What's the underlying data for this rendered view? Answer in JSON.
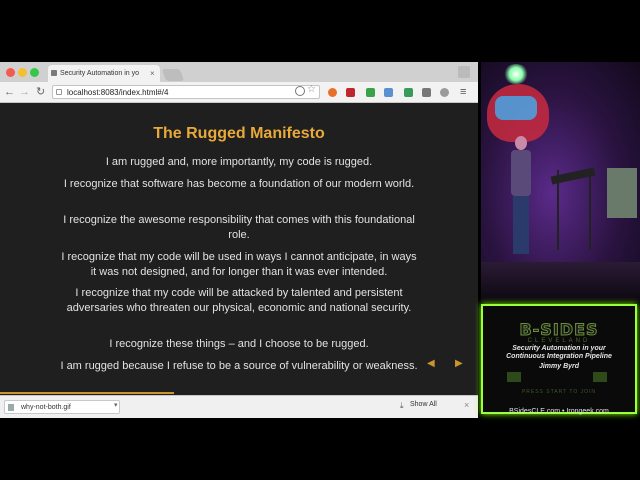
{
  "browser": {
    "tab_title": "Security Automation in yo",
    "tab_close": "×",
    "url": "localhost:8083/index.html#/4",
    "nav": {
      "back": "←",
      "forward": "→",
      "reload": "↻",
      "menu": "≡"
    }
  },
  "slide": {
    "title": "The Rugged Manifesto",
    "paragraphs": [
      "I am rugged and, more importantly, my code is rugged.",
      "I recognize that software has become a foundation of our modern world.",
      "I recognize the awesome responsibility that comes with this foundational role.",
      "I recognize that my code will be used in ways I cannot anticipate, in ways it was not designed, and for longer than it was ever intended.",
      "I recognize that my code will be attacked by talented and persistent adversaries who threaten our physical, economic and national security.",
      "I recognize these things – and I choose to be rugged.",
      "I am rugged because I refuse to be a source of vulnerability or weakness."
    ],
    "prev_arrow": "◀",
    "next_arrow": "▶"
  },
  "downloads": {
    "file_name": "why-not-both.gif",
    "caret": "▾",
    "show_all": "Show All",
    "close": "×"
  },
  "overlay": {
    "logo_title": "B-SIDES",
    "logo_sub": "CLEVELAND",
    "talk_title_1": "Security Automation in your",
    "talk_title_2": "Continuous Integration Pipeline",
    "speaker": "Jimmy Byrd",
    "press_start": "PRESS START TO JOIN",
    "footer": "BSidesCLE.com • Irongeek.com"
  },
  "colors": {
    "accent": "#e9a93a",
    "logo_border": "#9bff3a"
  }
}
